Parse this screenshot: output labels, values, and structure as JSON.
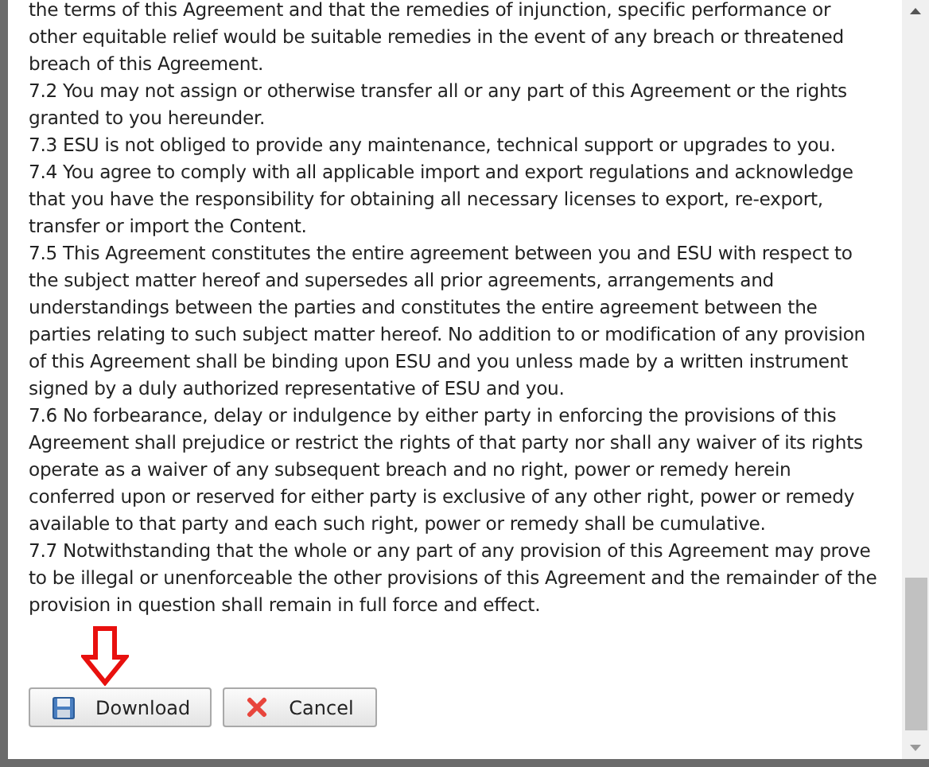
{
  "paragraphs": [
    "the terms of this Agreement and that the remedies of injunction, specific performance or other equitable relief would be suitable remedies in the event of any breach or threatened breach of this Agreement.",
    "7.2 You may not assign or otherwise transfer all or any part of this Agreement or the rights granted to you hereunder.",
    "7.3 ESU is not obliged to provide any maintenance, technical support or upgrades to you.",
    "7.4 You agree to comply with all applicable import and export regulations and acknowledge that you have the responsibility for obtaining all necessary licenses to export, re-export, transfer or import the Content.",
    "7.5 This Agreement constitutes the entire agreement between you and ESU with respect to the subject matter hereof and supersedes all prior agreements, arrangements and understandings between the parties and constitutes the entire agreement between the parties relating to such subject matter hereof. No addition to or modification of any provision of this Agreement shall be binding upon ESU and you unless made by a written instrument signed by a duly authorized representative of ESU and you.",
    "7.6 No forbearance, delay or indulgence by either party in enforcing the provisions of this Agreement shall prejudice or restrict the rights of that party nor shall any waiver of its rights operate as a waiver of any subsequent breach and no right, power or remedy herein conferred upon or reserved for either party is exclusive of any other right, power or remedy available to that party and each such right, power or remedy shall be cumulative.",
    "7.7 Notwithstanding that the whole or any part of any provision of this Agreement may prove to be illegal or unenforceable the other provisions of this Agreement and the remainder of the provision in question shall remain in full force and effect."
  ],
  "buttons": [
    {
      "label": "Download",
      "kind": "download"
    },
    {
      "label": "Cancel",
      "kind": "cancel"
    }
  ]
}
